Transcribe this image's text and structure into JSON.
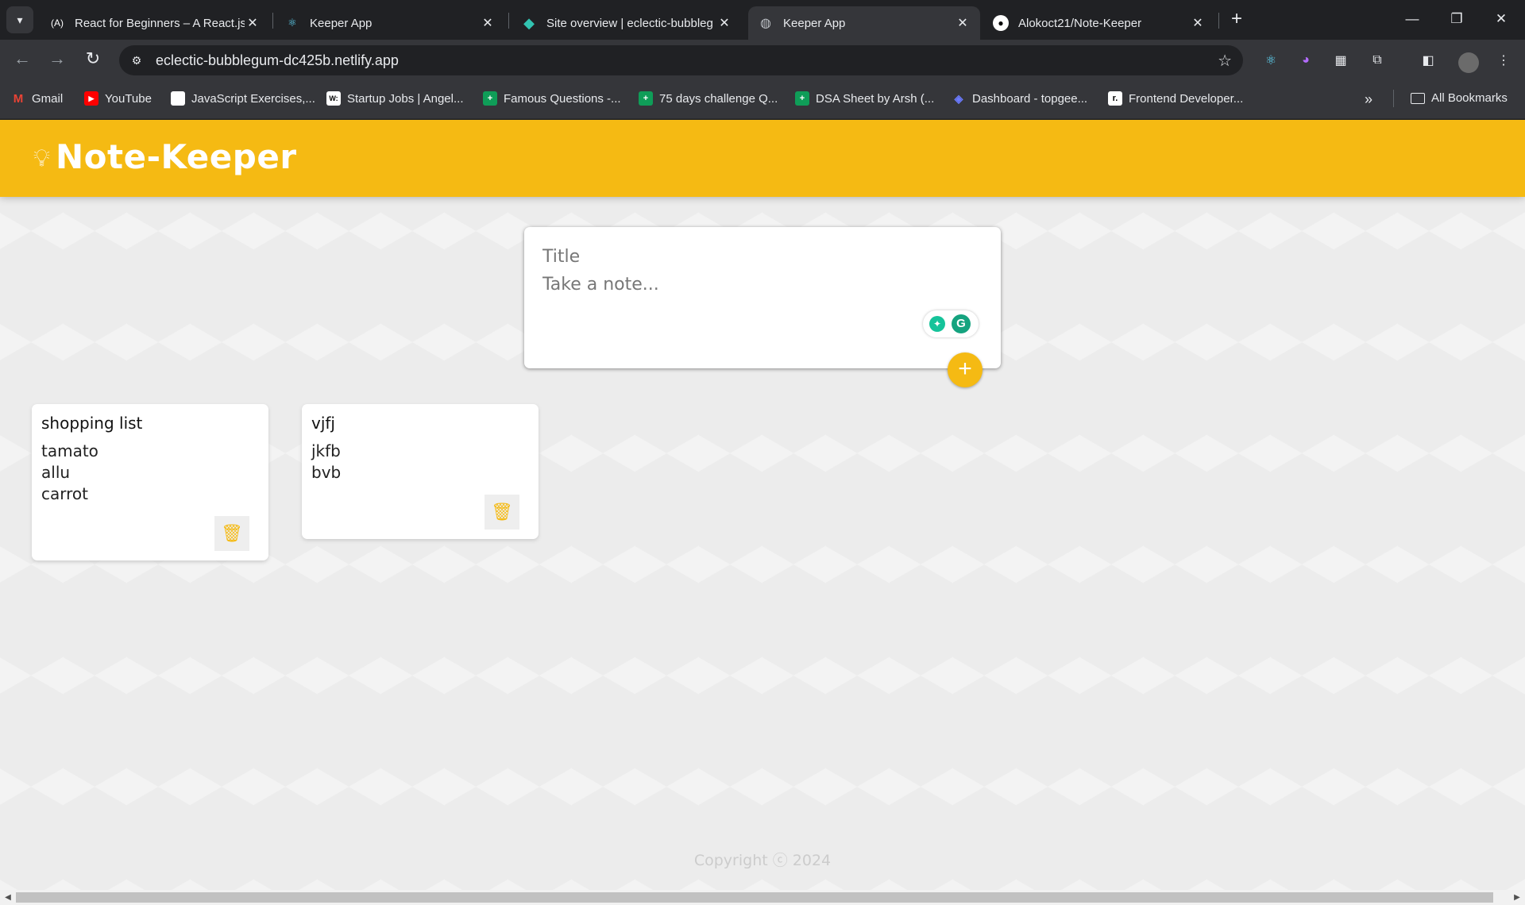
{
  "browser": {
    "tabs": [
      {
        "title": "React for Beginners – A React.js",
        "icon": "react-logo-icon",
        "active": false
      },
      {
        "title": "Keeper App",
        "icon": "react-atom-icon",
        "active": false
      },
      {
        "title": "Site overview | eclectic-bubbleg",
        "icon": "netlify-icon",
        "active": false
      },
      {
        "title": "Keeper App",
        "icon": "globe-icon",
        "active": true
      },
      {
        "title": "Alokoct21/Note-Keeper",
        "icon": "github-icon",
        "active": false
      }
    ],
    "address": "eclectic-bubblegum-dc425b.netlify.app",
    "bookmarks": [
      {
        "label": "Gmail",
        "icon": "gmail-icon"
      },
      {
        "label": "YouTube",
        "icon": "youtube-icon"
      },
      {
        "label": "JavaScript Exercises,...",
        "icon": "page-icon"
      },
      {
        "label": "Startup Jobs | Angel...",
        "icon": "wellfound-icon"
      },
      {
        "label": "Famous Questions -...",
        "icon": "sheets-icon"
      },
      {
        "label": "75 days challenge Q...",
        "icon": "sheets-icon"
      },
      {
        "label": "DSA Sheet by Arsh (...",
        "icon": "sheets-icon"
      },
      {
        "label": "Dashboard - topgee...",
        "icon": "topgeek-icon"
      },
      {
        "label": "Frontend Developer...",
        "icon": "frontend-icon"
      }
    ],
    "all_bookmarks": "All Bookmarks"
  },
  "app": {
    "name": "Note-Keeper",
    "create": {
      "title_placeholder": "Title",
      "content_placeholder": "Take a note..."
    },
    "notes": [
      {
        "title": "shopping list",
        "lines": [
          "tamato",
          "allu",
          "carrot"
        ]
      },
      {
        "title": "vjfj",
        "lines": [
          "jkfb",
          "bvb"
        ]
      }
    ],
    "footer": "Copyright ⓒ 2024",
    "colors": {
      "accent": "#f5ba13",
      "background": "#ececec"
    }
  }
}
